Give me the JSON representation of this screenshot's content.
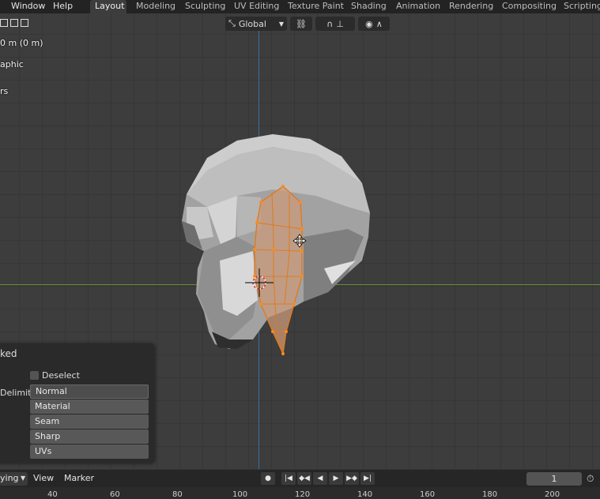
{
  "menu": [
    "Window",
    "Help"
  ],
  "workspaces": {
    "tabs": [
      "Layout",
      "Modeling",
      "Sculpting",
      "UV Editing",
      "Texture Paint",
      "Shading",
      "Animation",
      "Rendering",
      "Compositing",
      "Scripting"
    ],
    "active": "Layout"
  },
  "viewport_toolbar": {
    "orientation": "Global",
    "orientation_icon": "transform-orientation-icon",
    "pivot_icon": "link-icon",
    "snap_icon": "magnet-icon",
    "proportional_icon": "proportional-edit-icon",
    "falloff_icon": "falloff-curve-icon"
  },
  "overlay_text": {
    "line1": "0 m (0 m)",
    "line2": "aphic",
    "line3": "rs"
  },
  "operator_panel": {
    "title": "ked",
    "deselect_label": "Deselect",
    "deselect_checked": false,
    "delimit_label": "Delimit",
    "delimit_options": [
      "Normal",
      "Material",
      "Seam",
      "Sharp",
      "UVs"
    ],
    "delimit_active": "Normal"
  },
  "timeline": {
    "playback_label": "ying",
    "view_label": "View",
    "marker_label": "Marker",
    "current_frame": "1",
    "ruler": [
      "40",
      "60",
      "80",
      "100",
      "120",
      "140",
      "160",
      "180",
      "200"
    ]
  },
  "colors": {
    "selection_orange": "#e07a1f",
    "mesh_gray": "#a8a8a8",
    "axis_blue": "#3b6ea0",
    "axis_green": "#6a8a35"
  }
}
